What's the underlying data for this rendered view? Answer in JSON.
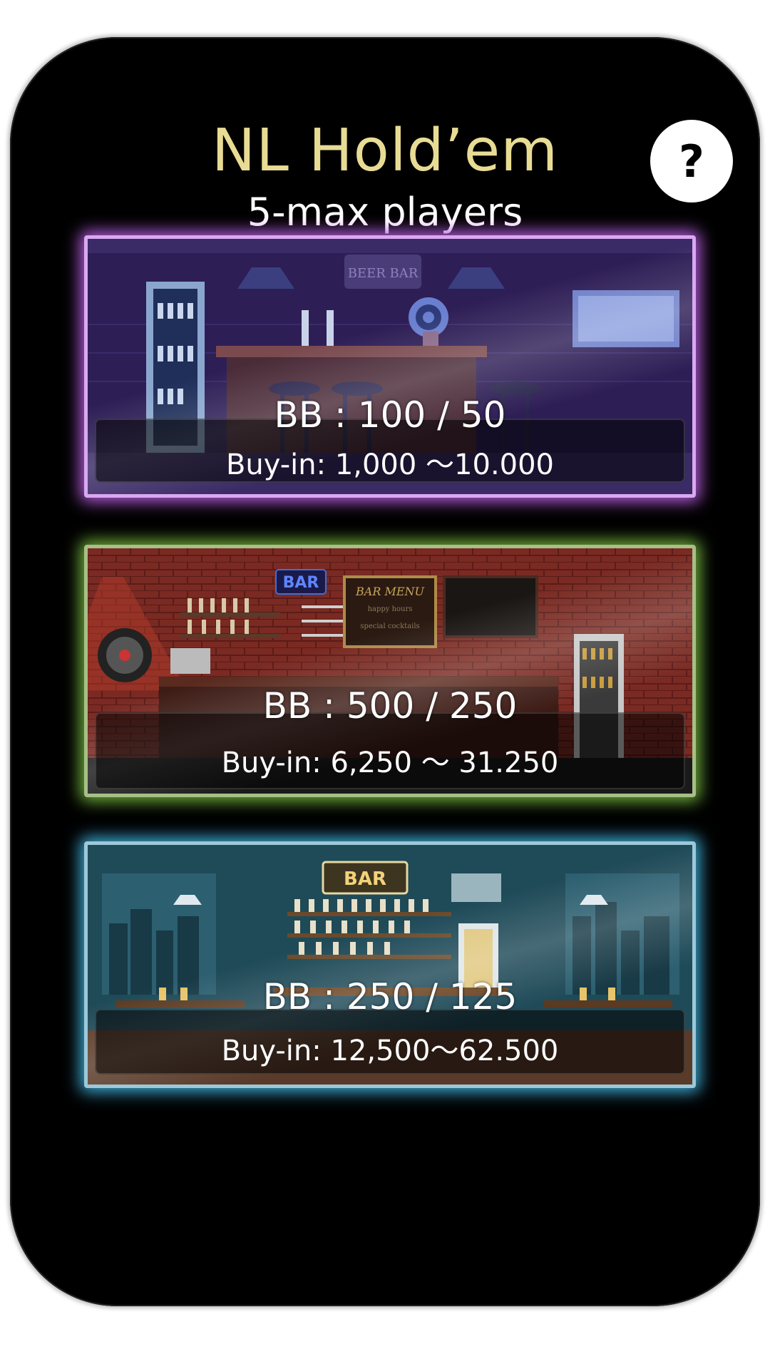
{
  "header": {
    "title": "NL Hold’em",
    "subtitle": "5-max players",
    "help_label": "?"
  },
  "rooms": [
    {
      "theme": "purple",
      "bb": "BB : 100 / 50",
      "buyin": "Buy-in: 1,000 ～10.000",
      "sign": "BEER BAR",
      "glow_color": "#b05ad8"
    },
    {
      "theme": "green",
      "bb": "BB : 500 / 250",
      "buyin": "Buy-in: 6,250 ～ 31.250",
      "sign": "BAR",
      "menu_title": "BAR MENU",
      "menu_line1": "happy hours",
      "menu_line2": "special cocktails",
      "glow_color": "#6fae3c"
    },
    {
      "theme": "blue",
      "bb": "BB : 250 / 125",
      "buyin": "Buy-in: 12,500～62.500",
      "sign": "BAR",
      "glow_color": "#3ca6cf"
    }
  ]
}
